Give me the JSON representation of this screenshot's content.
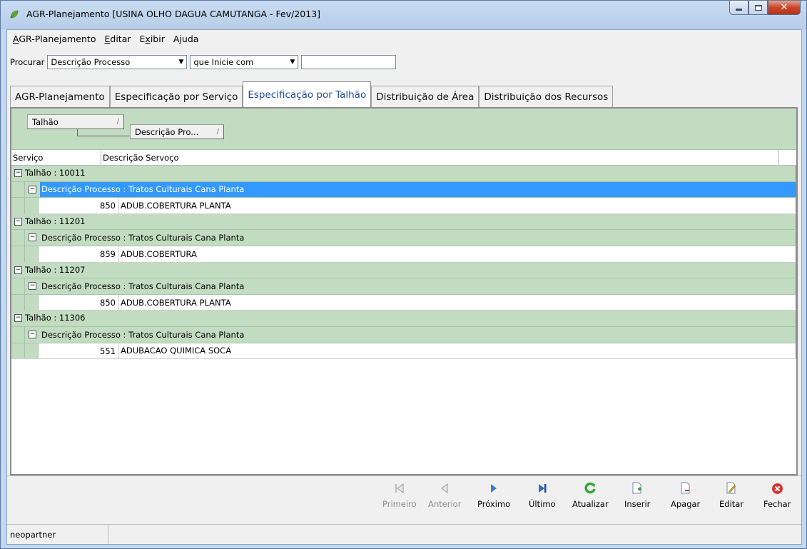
{
  "window": {
    "title": "AGR-Planejamento [USINA OLHO  DAGUA CAMUTANGA - Fev/2013]"
  },
  "menu": [
    {
      "label": "AGR-Planejamento",
      "accel": "A"
    },
    {
      "label": "Editar",
      "accel": "E"
    },
    {
      "label": "Exibir",
      "accel": "x"
    },
    {
      "label": "Ajuda",
      "accel": "j"
    }
  ],
  "search": {
    "label": "Procurar",
    "field_value": "Descrição Processo",
    "mode_value": "que Inicie com",
    "text_value": ""
  },
  "tabs": [
    {
      "label": "AGR-Planejamento",
      "active": false
    },
    {
      "label": "Especificação por Serviço",
      "active": false
    },
    {
      "label": "Especificação por Talhão",
      "active": true
    },
    {
      "label": "Distribuição de Área",
      "active": false
    },
    {
      "label": "Distribuição dos Recursos",
      "active": false
    }
  ],
  "group_panel": {
    "chip1": "Talhão",
    "chip2": "Descrição Pro...",
    "sort_glyph": "/"
  },
  "grid": {
    "columns": [
      "Serviço",
      "Descrição Servoço"
    ],
    "groups": [
      {
        "label": "Talhão : 10011",
        "sub": "Descrição Processo : Tratos Culturais Cana Planta",
        "selected": true,
        "rows": [
          {
            "code": "850",
            "desc": "ADUB.COBERTURA PLANTA"
          }
        ]
      },
      {
        "label": "Talhão : 11201",
        "sub": "Descrição Processo : Tratos Culturais Cana Planta",
        "selected": false,
        "rows": [
          {
            "code": "859",
            "desc": "ADUB.COBERTURA"
          }
        ]
      },
      {
        "label": "Talhão : 11207",
        "sub": "Descrição Processo : Tratos Culturais Cana Planta",
        "selected": false,
        "rows": [
          {
            "code": "850",
            "desc": "ADUB.COBERTURA PLANTA"
          }
        ]
      },
      {
        "label": "Talhão : 11306",
        "sub": "Descrição Processo : Tratos Culturais Cana Planta",
        "selected": false,
        "rows": [
          {
            "code": "551",
            "desc": "ADUBACAO QUIMICA SOCA"
          }
        ]
      }
    ]
  },
  "toolbar": {
    "primeiro": "Primeiro",
    "anterior": "Anterior",
    "proximo": "Próximo",
    "ultimo": "Último",
    "atualizar": "Atualizar",
    "inserir": "Inserir",
    "apagar": "Apagar",
    "editar": "Editar",
    "fechar": "Fechar"
  },
  "status": {
    "user": "neopartner"
  },
  "colors": {
    "group_bg": "#c2dcc2",
    "selection": "#3399ff",
    "active_tab_text": "#1d4d9e"
  }
}
